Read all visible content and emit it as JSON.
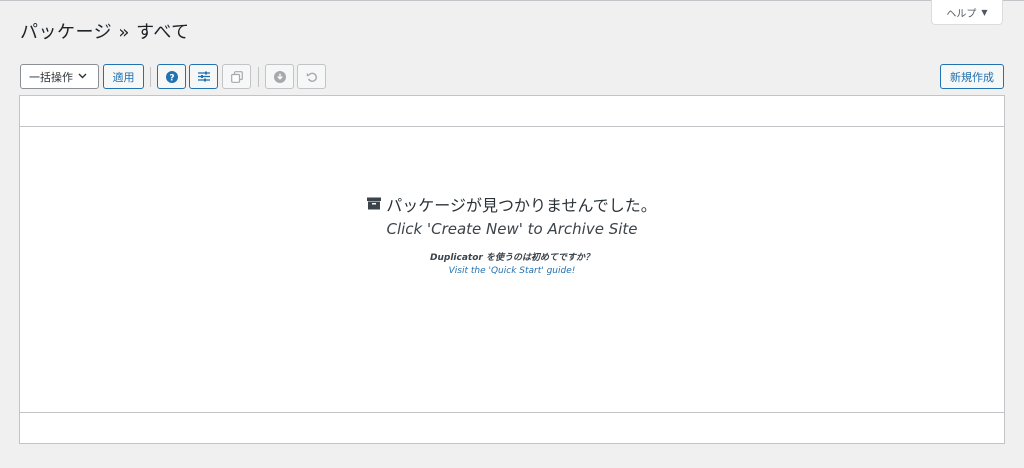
{
  "header": {
    "help_label": "ヘルプ",
    "title": "パッケージ » すべて"
  },
  "toolbar": {
    "bulk_action_label": "一括操作",
    "apply_label": "適用",
    "new_label": "新規作成",
    "icons": [
      "help-icon",
      "filter-icon",
      "copy-icon",
      "download-icon",
      "undo-icon"
    ]
  },
  "empty_state": {
    "title": "パッケージが見つかりませんでした。",
    "subtitle": "Click 'Create New' to Archive Site",
    "first_time_product": "Duplicator",
    "first_time_text": " を使うのは初めてですか？",
    "guide_link": "Visit the 'Quick Start' guide!"
  },
  "colors": {
    "accent": "#2271b1",
    "background": "#f0f0f1",
    "border": "#c3c4c7"
  }
}
